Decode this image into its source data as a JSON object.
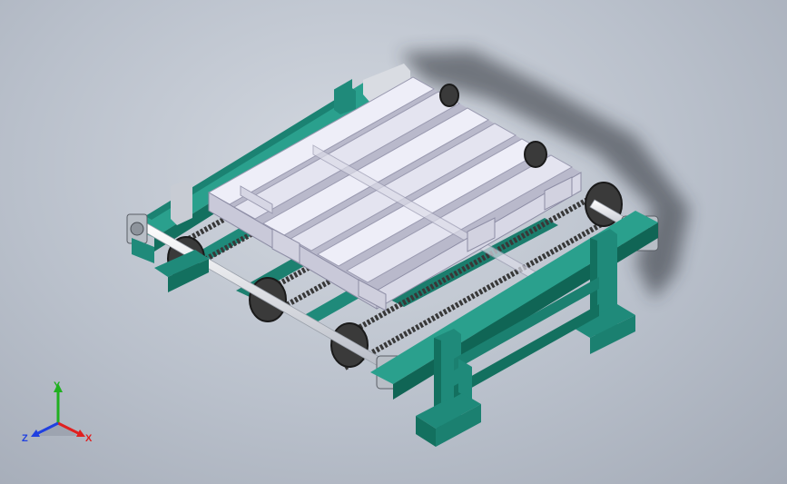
{
  "viewport": {
    "background_top": "#d3d8e0",
    "background_bottom": "#a3aab6"
  },
  "model": {
    "frame_color": "#1f8a7a",
    "frame_dark": "#106555",
    "pallet_color": "#e6e6f2",
    "pallet_shade": "#c2c2d2",
    "chain_color": "#3b3b3b",
    "shaft_color": "#f0f0f4",
    "bearing_color": "#b8bec6"
  },
  "triad": {
    "x_label": "X",
    "y_label": "Y",
    "z_label": "Z",
    "x_color": "#e02020",
    "y_color": "#20b020",
    "z_color": "#2040e0",
    "x_icon": "axis-x-arrow",
    "y_icon": "axis-y-arrow",
    "z_icon": "axis-z-arrow"
  }
}
